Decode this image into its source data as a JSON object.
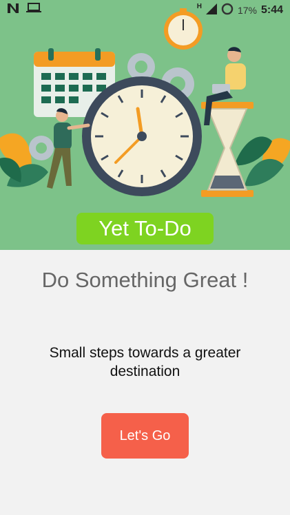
{
  "status_bar": {
    "battery_percent": "17%",
    "time": "5:44",
    "network_type": "H",
    "icons": [
      "n-logo-icon",
      "laptop-icon",
      "signal-icon",
      "battery-ring-icon"
    ]
  },
  "hero": {
    "badge_text": "Yet To-Do",
    "background_color": "#7dc289",
    "badge_color": "#7ed321"
  },
  "main": {
    "headline": "Do Something Great !",
    "tagline": "Small steps towards a greater destination",
    "cta_label": "Let's Go",
    "cta_color": "#f5604a"
  }
}
